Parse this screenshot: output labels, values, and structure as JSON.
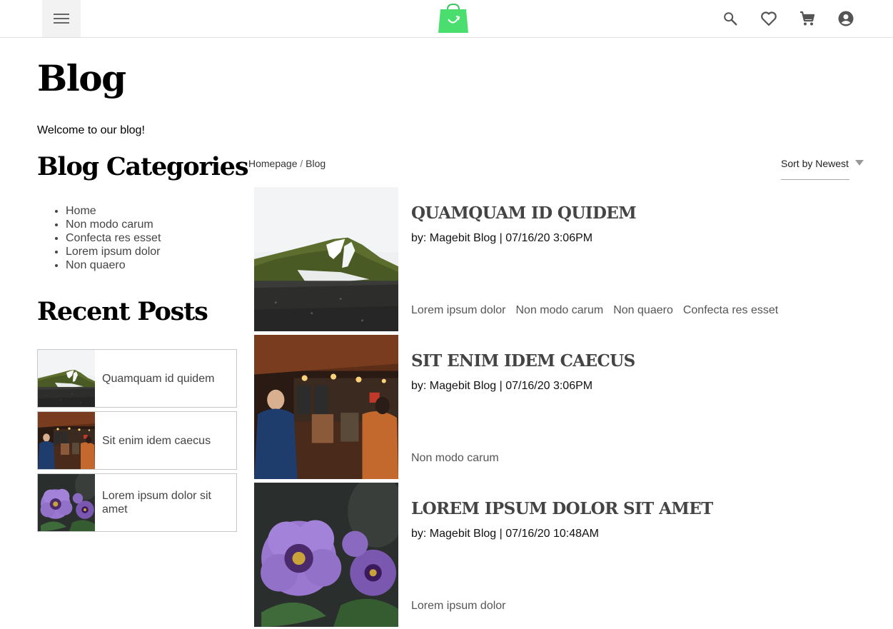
{
  "header": {
    "menu_icon": "hamburger-menu-icon",
    "logo_icon": "shopping-bag-logo-icon",
    "icons": [
      "search-icon",
      "heart-icon",
      "cart-icon",
      "account-icon"
    ],
    "logo_color": "#4ade6f"
  },
  "page": {
    "title": "Blog",
    "welcome": "Welcome to our blog!"
  },
  "sidebar": {
    "categories_heading": "Blog Categories",
    "categories": [
      {
        "label": "Home"
      },
      {
        "label": "Non modo carum"
      },
      {
        "label": "Confecta res esset"
      },
      {
        "label": "Lorem ipsum dolor"
      },
      {
        "label": "Non quaero"
      }
    ],
    "recent_heading": "Recent Posts",
    "recent": [
      {
        "title": "Quamquam id quidem",
        "image": "mountain-photo"
      },
      {
        "title": "Sit enim idem caecus",
        "image": "cafe-photo"
      },
      {
        "title": "Lorem ipsum dolor sit amet",
        "image": "flower-photo"
      }
    ]
  },
  "toolbar": {
    "breadcrumb": [
      {
        "label": "Homepage"
      },
      {
        "label": "Blog"
      }
    ],
    "breadcrumb_separator": "/",
    "sort_label": "Sort by Newest"
  },
  "posts": [
    {
      "title": "QUAMQUAM ID QUIDEM",
      "meta": "by: Magebit Blog | 07/16/20 3:06PM",
      "tags": [
        "Lorem ipsum dolor",
        "Non modo carum",
        "Non quaero",
        "Confecta res esset"
      ],
      "image": "mountain-photo"
    },
    {
      "title": "SIT ENIM IDEM CAECUS",
      "meta": "by: Magebit Blog | 07/16/20 3:06PM",
      "tags": [
        "Non modo carum"
      ],
      "image": "cafe-photo"
    },
    {
      "title": "LOREM IPSUM DOLOR SIT AMET",
      "meta": "by: Magebit Blog | 07/16/20 10:48AM",
      "tags": [
        "Lorem ipsum dolor"
      ],
      "image": "flower-photo"
    }
  ]
}
